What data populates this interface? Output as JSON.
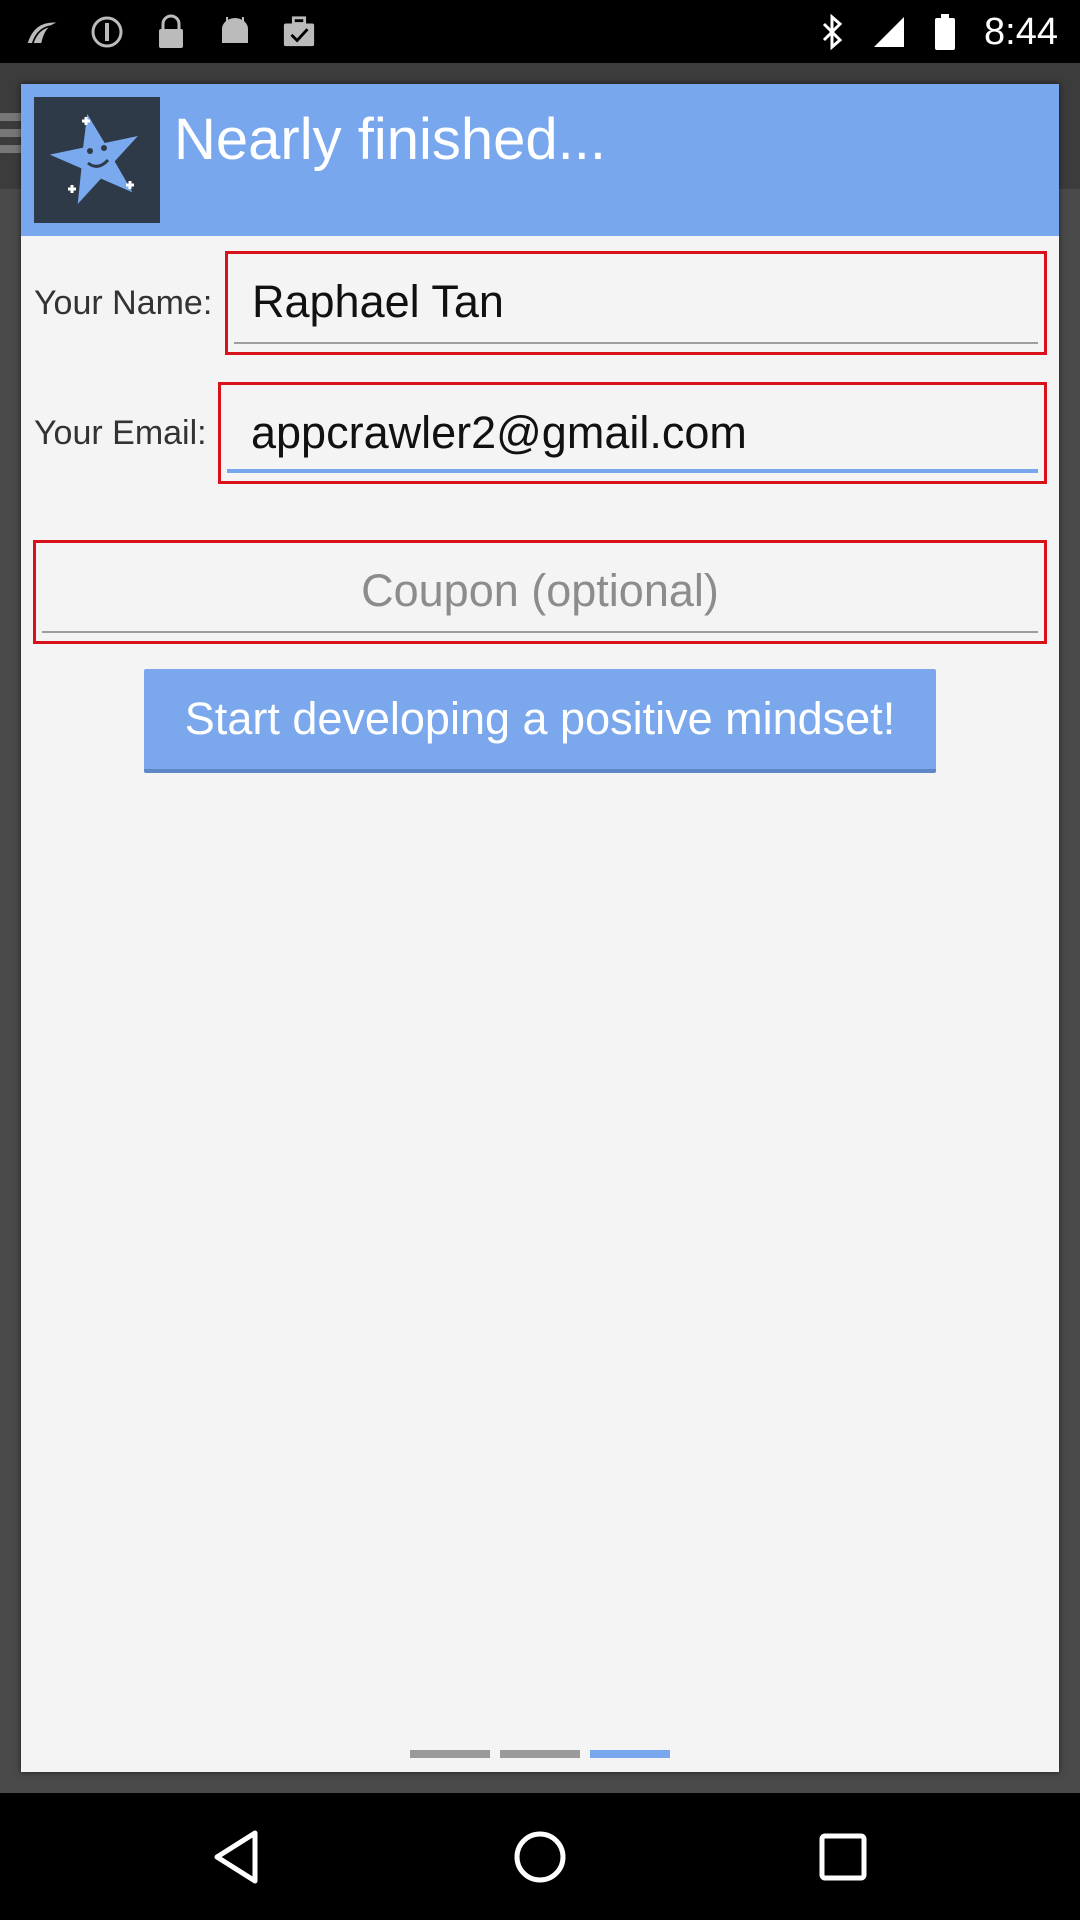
{
  "status_bar": {
    "time": "8:44",
    "icons": [
      "wave-icon",
      "alert-circle-icon",
      "lock-icon",
      "android-icon",
      "briefcase-check-icon",
      "bluetooth-icon",
      "signal-icon",
      "battery-icon"
    ]
  },
  "dialog": {
    "title": "Nearly finished...",
    "logo_icon": "star-face-icon",
    "name_label": "Your Name:",
    "name_value": "Raphael Tan",
    "email_label": "Your Email:",
    "email_value": "appcrawler2@gmail.com",
    "coupon_placeholder": "Coupon (optional)",
    "cta_label": "Start developing a positive mindset!",
    "pager": {
      "pages": 3,
      "active_index": 2
    }
  },
  "nav_bar": {
    "buttons": [
      "back-icon",
      "home-icon",
      "recents-icon"
    ]
  },
  "colors": {
    "header": "#79a7ee",
    "highlight_border": "#d9111a",
    "button": "#7ba8ec",
    "dialog_bg": "#f4f4f4"
  }
}
